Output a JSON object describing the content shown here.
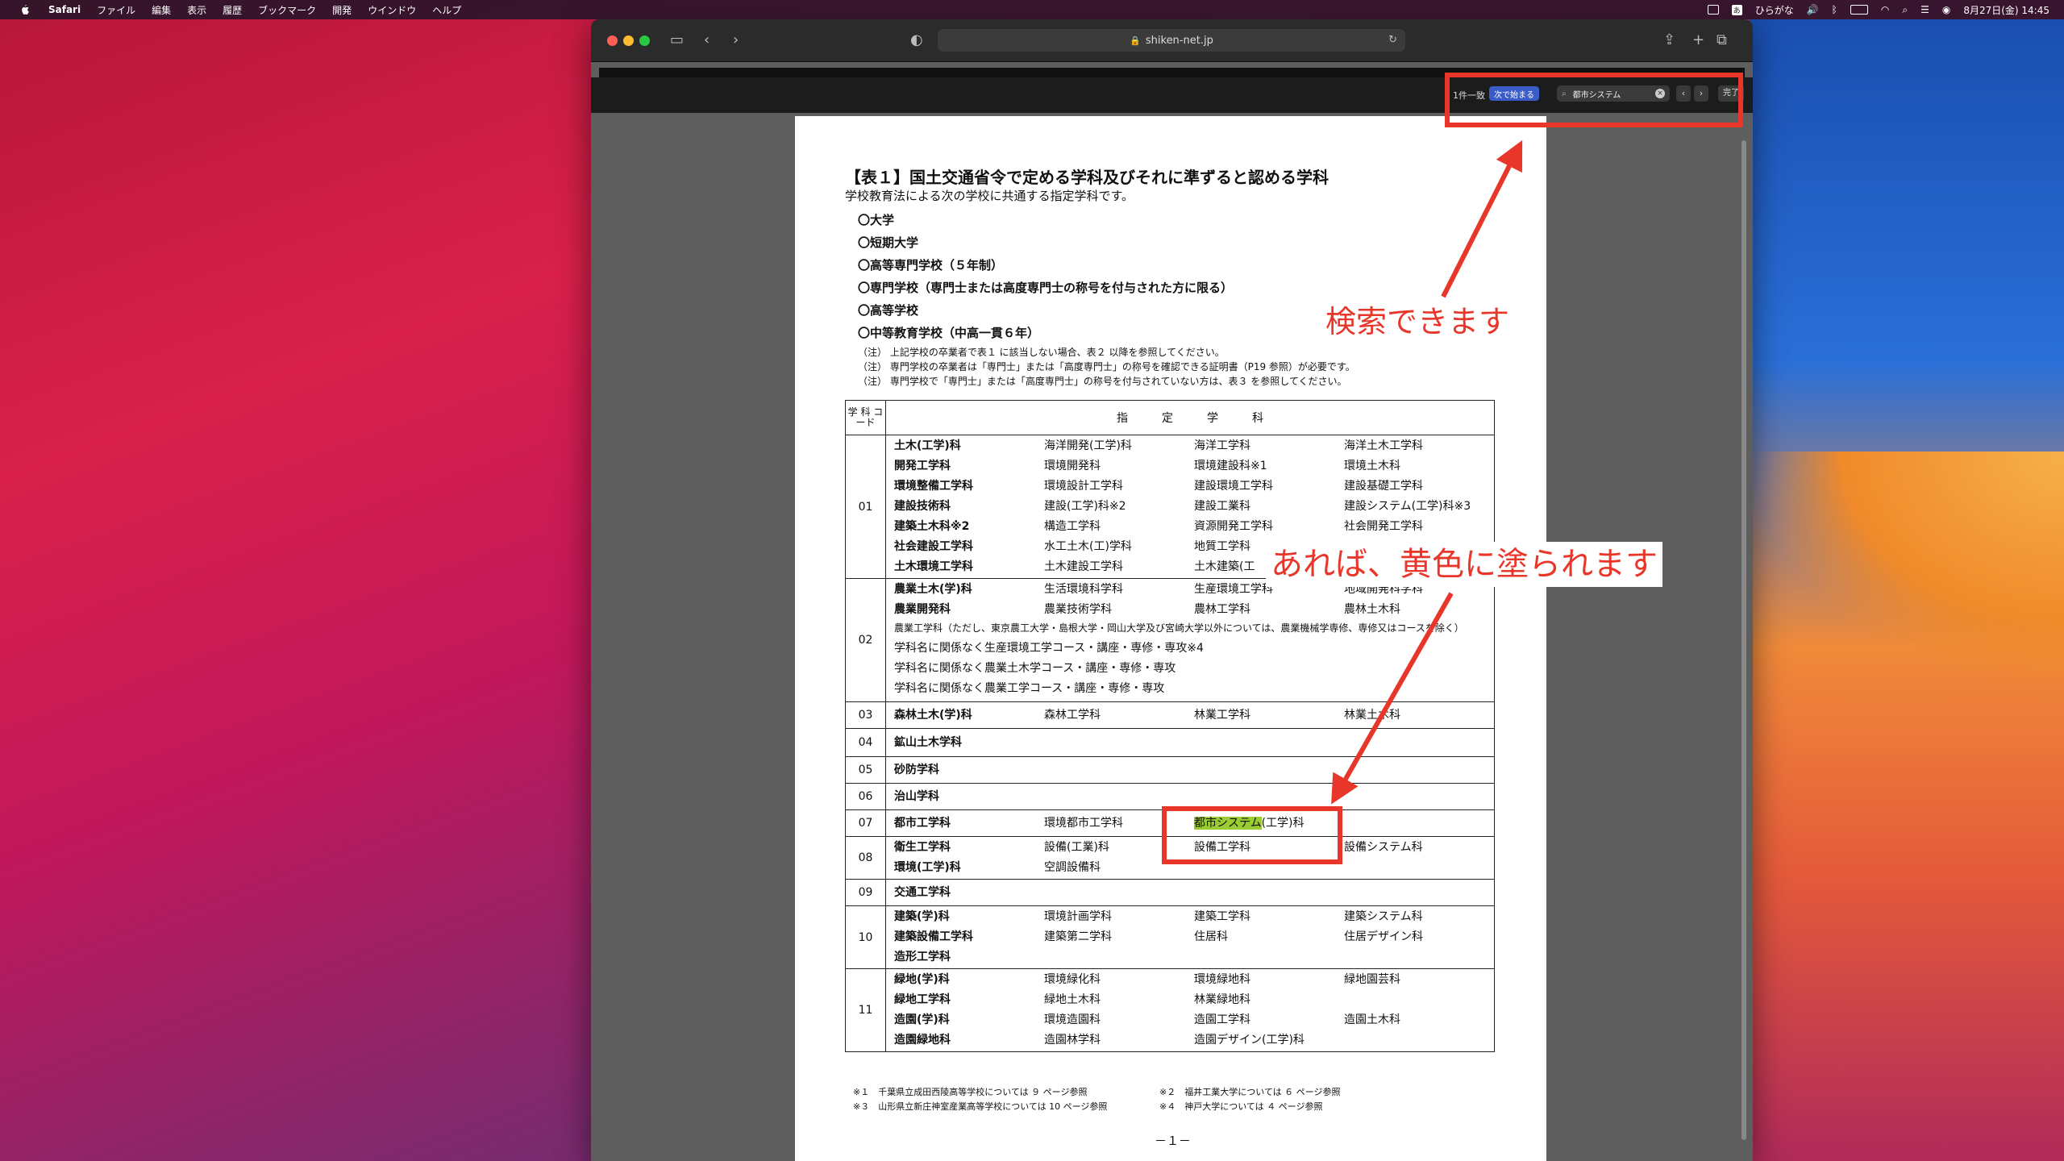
{
  "menubar": {
    "app": "Safari",
    "items": [
      "ファイル",
      "編集",
      "表示",
      "履歴",
      "ブックマーク",
      "開発",
      "ウインドウ",
      "ヘルプ"
    ],
    "ime": "あ",
    "ime_label": "ひらがな",
    "clock": "8月27日(金) 14:45"
  },
  "browser": {
    "url": "shiken-net.jp",
    "find": {
      "count": "1件一致",
      "mode": "次で始まる",
      "query": "都市システム",
      "done": "完了"
    }
  },
  "doc": {
    "title": "【表１】国土交通省令で定める学科及びそれに準ずると認める学科",
    "subtitle": "学校教育法による次の学校に共通する指定学科です。",
    "schools": [
      "〇大学",
      "〇短期大学",
      "〇高等専門学校（５年制）",
      "〇専門学校（専門士または高度専門士の称号を付与された方に限る）",
      "〇高等学校",
      "〇中等教育学校（中高一貫６年）"
    ],
    "notes": [
      "（注） 上記学校の卒業者で表１ に該当しない場合、表２ 以降を参照してください。",
      "（注） 専門学校の卒業者は「専門士」または「高度専門士」の称号を確認できる証明書（P19 参照）が必要です。",
      "（注） 専門学校で「専門士」または「高度専門士」の称号を付与されていない方は、表３ を参照してください。"
    ],
    "table_header": {
      "code": "学 科 コード",
      "subjects": "指　　　定　　　学　　　科"
    },
    "rows": [
      {
        "code": "01",
        "cells": [
          [
            "土木(工学)科",
            "海洋開発(工学)科",
            "海洋工学科",
            "海洋土木工学科"
          ],
          [
            "開発工学科",
            "環境開発科",
            "環境建設科※1",
            "環境土木科"
          ],
          [
            "環境整備工学科",
            "環境設計工学科",
            "建設環境工学科",
            "建設基礎工学科"
          ],
          [
            "建設技術科",
            "建設(工学)科※2",
            "建設工業科",
            "建設システム(工学)科※3"
          ],
          [
            "建築土木科※2",
            "構造工学科",
            "資源開発工学科",
            "社会開発工学科"
          ],
          [
            "社会建設工学科",
            "水工土木(工)学科",
            "地質工学科",
            ""
          ],
          [
            "土木環境工学科",
            "土木建設工学科",
            "土木建築(工",
            ""
          ]
        ]
      },
      {
        "code": "02",
        "cells": [
          [
            "農業土木(学)科",
            "生活環境科学科",
            "生産環境工学科",
            "地域開発科学科"
          ],
          [
            "農業開発科",
            "農業技術学科",
            "農林工学科",
            "農林土木科"
          ]
        ],
        "lines": [
          "農業工学科（ただし、東京農工大学・島根大学・岡山大学及び宮崎大学以外については、農業機械学専修、専修又はコースを除く）",
          "学科名に関係なく生産環境工学コース・講座・専修・専攻※4",
          "学科名に関係なく農業土木学コース・講座・専修・専攻",
          "学科名に関係なく農業工学コース・講座・専修・専攻"
        ]
      },
      {
        "code": "03",
        "cells": [
          [
            "森林土木(学)科",
            "森林工学科",
            "林業工学科",
            "林業土木科"
          ]
        ]
      },
      {
        "code": "04",
        "cells": [
          [
            "鉱山土木学科",
            "",
            "",
            ""
          ]
        ]
      },
      {
        "code": "05",
        "cells": [
          [
            "砂防学科",
            "",
            "",
            ""
          ]
        ]
      },
      {
        "code": "06",
        "cells": [
          [
            "治山学科",
            "",
            "",
            ""
          ]
        ]
      },
      {
        "code": "07",
        "cells": [
          [
            "都市工学科",
            "環境都市工学科",
            "",
            ""
          ]
        ],
        "highlight": {
          "match": "都市システム",
          "rest": "(工学)科"
        }
      },
      {
        "code": "08",
        "cells": [
          [
            "衛生工学科",
            "設備(工業)科",
            "設備工学科",
            "設備システム科"
          ],
          [
            "環境(工学)科",
            "空調設備科",
            "",
            ""
          ]
        ]
      },
      {
        "code": "09",
        "cells": [
          [
            "交通工学科",
            "",
            "",
            ""
          ]
        ]
      },
      {
        "code": "10",
        "cells": [
          [
            "建築(学)科",
            "環境計画学科",
            "建築工学科",
            "建築システム科"
          ],
          [
            "建築設備工学科",
            "建築第二学科",
            "住居科",
            "住居デザイン科"
          ],
          [
            "造形工学科",
            "",
            "",
            ""
          ]
        ]
      },
      {
        "code": "11",
        "cells": [
          [
            "緑地(学)科",
            "環境緑化科",
            "環境緑地科",
            "緑地園芸科"
          ],
          [
            "緑地工学科",
            "緑地土木科",
            "林業緑地科",
            ""
          ],
          [
            "造園(学)科",
            "環境造園科",
            "造園工学科",
            "造園土木科"
          ],
          [
            "造園緑地科",
            "造園林学科",
            "造園デザイン(工学)科",
            ""
          ]
        ]
      }
    ],
    "footnotes": [
      "※１　千葉県立成田西陵高等学校については ９ ページ参照",
      "※２　福井工業大学については ６ ページ参照",
      "※３　山形県立新庄神室産業高等学校については 10 ページ参照",
      "※４　神戸大学については ４ ページ参照"
    ],
    "page_number": "－１－"
  },
  "annotations": {
    "search": "検索できます",
    "highlight": "あれば、黄色に塗られます"
  },
  "colors": {
    "annotation": "#e8372a",
    "highlight": "#9acd32",
    "find_mode": "#3a5cc8"
  }
}
